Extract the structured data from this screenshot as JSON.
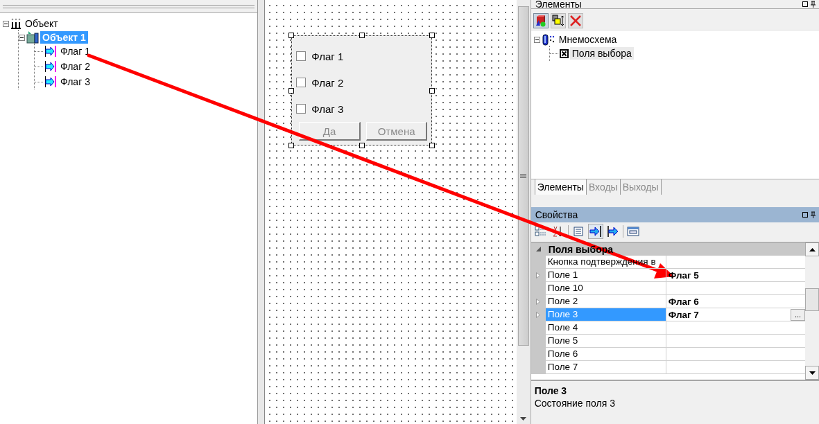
{
  "object_tree": [
    {
      "label": "Объект",
      "kind": "object-group",
      "expanded": true,
      "selected": false,
      "children": [
        {
          "label": "Объект 1",
          "kind": "object",
          "expanded": true,
          "selected": true,
          "children": [
            {
              "label": "Флаг 1",
              "kind": "flag",
              "selected": false
            },
            {
              "label": "Флаг 2",
              "kind": "flag",
              "selected": false
            },
            {
              "label": "Флаг 3",
              "kind": "flag",
              "selected": false
            }
          ]
        }
      ]
    }
  ],
  "form": {
    "checkboxes": [
      {
        "label": "Флаг 1",
        "checked": false
      },
      {
        "label": "Флаг 2",
        "checked": false
      },
      {
        "label": "Флаг 3",
        "checked": false
      }
    ],
    "buttons": [
      {
        "label": "Да",
        "disabled": true
      },
      {
        "label": "Отмена",
        "disabled": true
      }
    ]
  },
  "elements_panel": {
    "title": "Элементы",
    "toolbar": [
      {
        "kind": "add",
        "pressed": true
      },
      {
        "kind": "arrange",
        "pressed": false
      },
      {
        "kind": "delete",
        "pressed": false
      }
    ],
    "tree": [
      {
        "label": "Мнемосхема",
        "kind": "scheme",
        "expanded": true,
        "selected": false,
        "children": [
          {
            "label": "Поля выбора",
            "kind": "checkbox",
            "selected": true
          }
        ]
      }
    ],
    "tabs": [
      {
        "label": "Элементы",
        "selected": true
      },
      {
        "label": "Входы",
        "selected": false
      },
      {
        "label": "Выходы",
        "selected": false
      }
    ]
  },
  "properties_panel": {
    "title": "Свойства",
    "toolbar": [
      {
        "kind": "categorized",
        "pressed": false
      },
      {
        "kind": "sort",
        "pressed": false
      },
      {
        "kind": "list",
        "pressed": false
      },
      {
        "kind": "input",
        "pressed": true
      },
      {
        "kind": "output",
        "pressed": false
      },
      {
        "kind": "pages",
        "pressed": false
      }
    ],
    "category": "Поля выбора",
    "rows": [
      {
        "name": "Кнопка подтверждения в",
        "value": "",
        "expandable": false,
        "selected": false
      },
      {
        "name": "Поле 1",
        "value": "Флаг 5",
        "expandable": true,
        "selected": false
      },
      {
        "name": "Поле 10",
        "value": "",
        "expandable": false,
        "selected": false
      },
      {
        "name": "Поле 2",
        "value": "Флаг 6",
        "expandable": true,
        "selected": false
      },
      {
        "name": "Поле 3",
        "value": "Флаг 7",
        "expandable": true,
        "selected": true,
        "button": "..."
      },
      {
        "name": "Поле 4",
        "value": "",
        "expandable": false,
        "selected": false
      },
      {
        "name": "Поле 5",
        "value": "",
        "expandable": false,
        "selected": false
      },
      {
        "name": "Поле 6",
        "value": "",
        "expandable": false,
        "selected": false
      },
      {
        "name": "Поле 7",
        "value": "",
        "expandable": false,
        "selected": false
      }
    ],
    "description": {
      "title": "Поле 3",
      "text": "Состояние поля 3"
    }
  }
}
